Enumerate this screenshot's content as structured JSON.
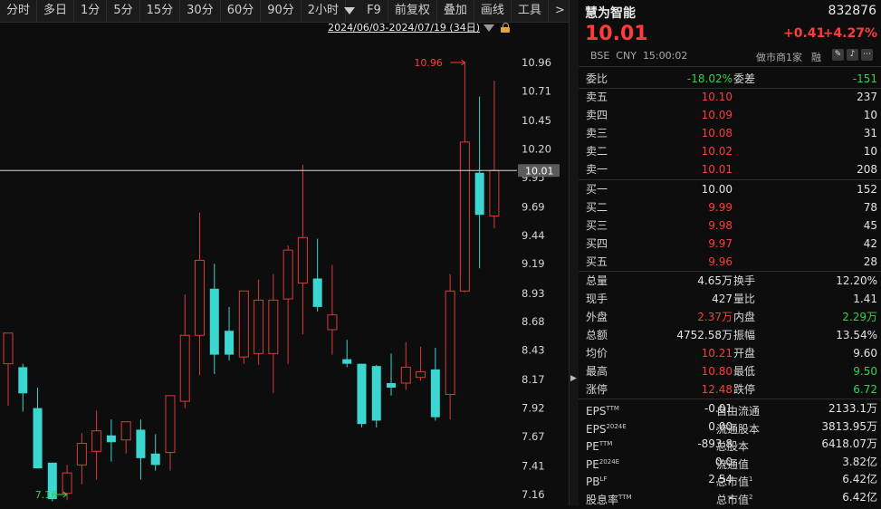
{
  "toolbar": {
    "items": [
      "分时",
      "多日",
      "1分",
      "5分",
      "15分",
      "30分",
      "60分",
      "90分",
      "2小时"
    ],
    "extra": [
      "F9",
      "前复权",
      "叠加",
      "画线",
      "工具",
      ">"
    ]
  },
  "date_range": "2024/06/03-2024/07/19 (34日)",
  "chart": {
    "y_ticks": [
      "10.96",
      "10.71",
      "10.45",
      "10.20",
      "9.95",
      "9.69",
      "9.44",
      "9.19",
      "8.93",
      "8.68",
      "8.43",
      "8.17",
      "7.92",
      "7.67",
      "7.41",
      "7.16"
    ],
    "current_price_label": "10.01",
    "high_label": "10.96",
    "low_label": "7.16"
  },
  "chart_data": {
    "type": "candlestick",
    "ylim": [
      7.16,
      10.96
    ],
    "current_price": 10.01,
    "candles": [
      {
        "o": 8.31,
        "h": 8.58,
        "l": 7.94,
        "c": 8.58
      },
      {
        "o": 8.28,
        "h": 8.31,
        "l": 7.89,
        "c": 8.05
      },
      {
        "o": 7.92,
        "h": 8.1,
        "l": 7.39,
        "c": 7.39
      },
      {
        "o": 7.44,
        "h": 7.44,
        "l": 7.1,
        "c": 7.12
      },
      {
        "o": 7.17,
        "h": 7.42,
        "l": 7.11,
        "c": 7.35
      },
      {
        "o": 7.42,
        "h": 7.7,
        "l": 7.25,
        "c": 7.61
      },
      {
        "o": 7.54,
        "h": 7.9,
        "l": 7.29,
        "c": 7.72
      },
      {
        "o": 7.68,
        "h": 7.82,
        "l": 7.45,
        "c": 7.62
      },
      {
        "o": 7.64,
        "h": 7.8,
        "l": 7.52,
        "c": 7.8
      },
      {
        "o": 7.73,
        "h": 7.82,
        "l": 7.29,
        "c": 7.48
      },
      {
        "o": 7.52,
        "h": 7.69,
        "l": 7.37,
        "c": 7.42
      },
      {
        "o": 7.53,
        "h": 8.03,
        "l": 7.37,
        "c": 8.03
      },
      {
        "o": 7.98,
        "h": 8.92,
        "l": 7.92,
        "c": 8.56
      },
      {
        "o": 8.56,
        "h": 9.64,
        "l": 8.21,
        "c": 9.22
      },
      {
        "o": 8.97,
        "h": 9.19,
        "l": 8.22,
        "c": 8.39
      },
      {
        "o": 8.6,
        "h": 8.81,
        "l": 8.34,
        "c": 8.39
      },
      {
        "o": 8.37,
        "h": 8.89,
        "l": 8.31,
        "c": 8.95
      },
      {
        "o": 8.4,
        "h": 9.05,
        "l": 8.3,
        "c": 8.87
      },
      {
        "o": 8.4,
        "h": 9.1,
        "l": 8.05,
        "c": 8.87
      },
      {
        "o": 8.88,
        "h": 9.35,
        "l": 8.31,
        "c": 9.31
      },
      {
        "o": 9.02,
        "h": 10.06,
        "l": 8.57,
        "c": 9.42
      },
      {
        "o": 9.06,
        "h": 9.41,
        "l": 8.77,
        "c": 8.81
      },
      {
        "o": 8.61,
        "h": 9.18,
        "l": 8.39,
        "c": 8.74
      },
      {
        "o": 8.35,
        "h": 8.52,
        "l": 8.28,
        "c": 8.31
      },
      {
        "o": 8.31,
        "h": 8.31,
        "l": 7.75,
        "c": 7.78
      },
      {
        "o": 8.29,
        "h": 8.3,
        "l": 7.75,
        "c": 7.81
      },
      {
        "o": 8.14,
        "h": 8.4,
        "l": 8.03,
        "c": 8.1
      },
      {
        "o": 8.14,
        "h": 8.5,
        "l": 8.08,
        "c": 8.28
      },
      {
        "o": 8.19,
        "h": 8.46,
        "l": 8.16,
        "c": 8.24
      },
      {
        "o": 8.26,
        "h": 8.45,
        "l": 7.81,
        "c": 7.84
      },
      {
        "o": 8.04,
        "h": 9.1,
        "l": 7.82,
        "c": 8.95
      },
      {
        "o": 8.95,
        "h": 10.96,
        "l": 8.94,
        "c": 10.26
      },
      {
        "o": 9.99,
        "h": 10.66,
        "l": 9.15,
        "c": 9.62
      },
      {
        "o": 9.61,
        "h": 10.8,
        "l": 9.5,
        "c": 10.01
      }
    ]
  },
  "panel": {
    "name": "慧为智能",
    "code": "832876",
    "price": "10.01",
    "change": "+0.41",
    "change_pct": "+4.27%",
    "exchange": "BSE",
    "currency": "CNY",
    "time": "15:00:02",
    "market_maker": "做市商1家",
    "rong": "融",
    "icons": [
      "edit-icon",
      "bell-icon",
      "more-icon"
    ],
    "weibi": {
      "label": "委比",
      "value": "-18.02%",
      "label2": "委差",
      "value2": "-151"
    },
    "asks": [
      {
        "label": "卖五",
        "price": "10.10",
        "vol": "237"
      },
      {
        "label": "卖四",
        "price": "10.09",
        "vol": "10"
      },
      {
        "label": "卖三",
        "price": "10.08",
        "vol": "31"
      },
      {
        "label": "卖二",
        "price": "10.02",
        "vol": "10"
      },
      {
        "label": "卖一",
        "price": "10.01",
        "vol": "208"
      }
    ],
    "bids": [
      {
        "label": "买一",
        "price": "10.00",
        "vol": "152"
      },
      {
        "label": "买二",
        "price": "9.99",
        "vol": "78"
      },
      {
        "label": "买三",
        "price": "9.98",
        "vol": "45"
      },
      {
        "label": "买四",
        "price": "9.97",
        "vol": "42"
      },
      {
        "label": "买五",
        "price": "9.96",
        "vol": "28"
      }
    ],
    "stats": [
      {
        "l1": "总量",
        "v1": "4.65万",
        "c1": "white",
        "l2": "换手",
        "v2": "12.20%",
        "c2": "white"
      },
      {
        "l1": "现手",
        "v1": "427",
        "c1": "white",
        "l2": "量比",
        "v2": "1.41",
        "c2": "white"
      },
      {
        "l1": "外盘",
        "v1": "2.37万",
        "c1": "red",
        "l2": "内盘",
        "v2": "2.29万",
        "c2": "green"
      },
      {
        "l1": "总额",
        "v1": "4752.58万",
        "c1": "white",
        "l2": "振幅",
        "v2": "13.54%",
        "c2": "white"
      },
      {
        "l1": "均价",
        "v1": "10.21",
        "c1": "red",
        "l2": "开盘",
        "v2": "9.60",
        "c2": "white"
      },
      {
        "l1": "最高",
        "v1": "10.80",
        "c1": "red",
        "l2": "最低",
        "v2": "9.50",
        "c2": "green"
      },
      {
        "l1": "涨停",
        "v1": "12.48",
        "c1": "red",
        "l2": "跌停",
        "v2": "6.72",
        "c2": "green"
      }
    ],
    "fundamentals": [
      {
        "l1": "EPS",
        "s1": "TTM",
        "v1": "-0.01",
        "l2": "自由流通",
        "s2": "",
        "v2": "2133.1万"
      },
      {
        "l1": "EPS",
        "s1": "2024E",
        "v1": "0.00",
        "l2": "流通股本",
        "s2": "",
        "v2": "3813.95万"
      },
      {
        "l1": "PE",
        "s1": "TTM",
        "v1": "-893.8",
        "l2": "总股本",
        "s2": "",
        "v2": "6418.07万"
      },
      {
        "l1": "PE",
        "s1": "2024E",
        "v1": "0.0",
        "l2": "流通值",
        "s2": "",
        "v2": "3.82亿"
      },
      {
        "l1": "PB",
        "s1": "LF",
        "v1": "2.54",
        "l2": "总市值",
        "s2": "1",
        "v2": "6.42亿"
      },
      {
        "l1": "股息率",
        "s1": "TTM",
        "v1": "-",
        "l2": "总市值",
        "s2": "2",
        "v2": "6.42亿"
      }
    ]
  },
  "colors": {
    "up": "#d93a3a",
    "down": "#3cd6d1",
    "bg": "#0d0d0d"
  }
}
